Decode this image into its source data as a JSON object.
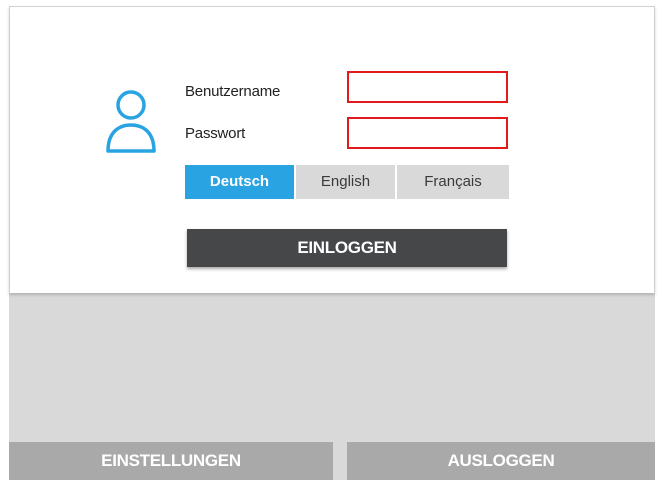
{
  "login_form": {
    "username_label": "Benutzername",
    "password_label": "Passwort",
    "username_value": "",
    "password_value": "",
    "user_icon": "user-outline-icon",
    "error_color": "#e11b1b"
  },
  "languages": {
    "selected": "Deutsch",
    "options": [
      "Deutsch",
      "English",
      "Français"
    ],
    "accent_color": "#29a3e2"
  },
  "login_button_label": "EINLOGGEN",
  "footer": {
    "settings_label": "EINSTELLUNGEN",
    "logout_label": "AUSLOGGEN"
  }
}
